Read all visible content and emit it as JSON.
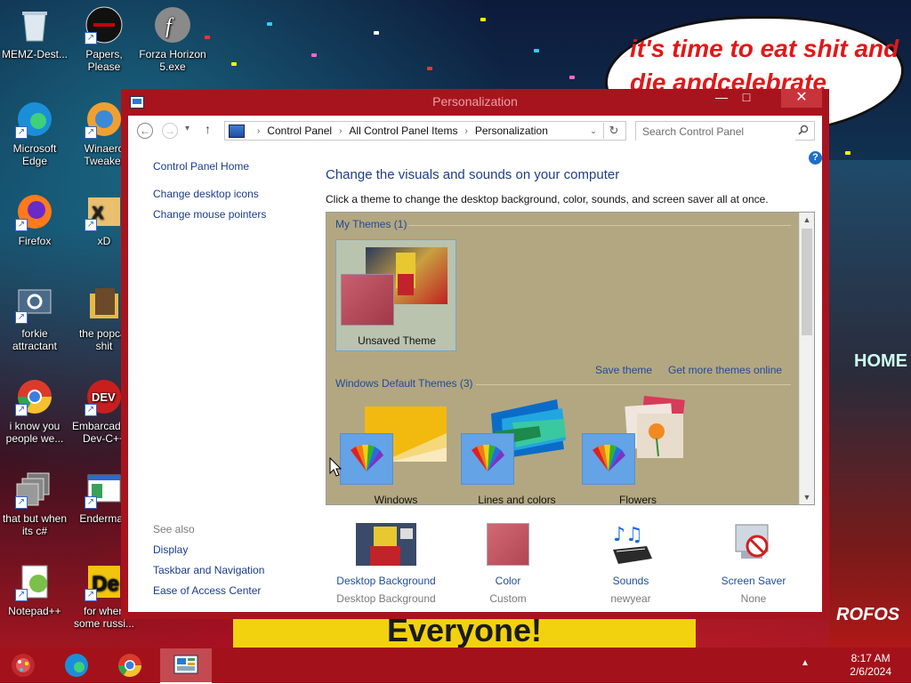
{
  "desktop": {
    "bubble_text": "it's time to eat shit and die andcelebrate",
    "banner_text": "Everyone!",
    "side_text": "ROFOS",
    "side_text2": "HOME",
    "icons": [
      {
        "label": "MEMZ-Dest...",
        "icon": "recycle-bin-icon"
      },
      {
        "label": "Papers, Please",
        "icon": "papers-please-icon"
      },
      {
        "label": "Forza Horizon 5.exe",
        "icon": "flash-icon"
      },
      {
        "label": "Microsoft Edge",
        "icon": "edge-icon"
      },
      {
        "label": "Winaero Tweaker",
        "icon": "winaero-icon"
      },
      {
        "label": "Firefox",
        "icon": "firefox-icon"
      },
      {
        "label": "xD",
        "icon": "xd-icon"
      },
      {
        "label": "forkie attractant",
        "icon": "settings-pc-icon"
      },
      {
        "label": "the popcat shit",
        "icon": "folder-icon"
      },
      {
        "label": "i know you people we...",
        "icon": "chrome-icon"
      },
      {
        "label": "Embarcadero Dev-C++",
        "icon": "devcpp-icon"
      },
      {
        "label": "that but when its c#",
        "icon": "copy-windows-icon"
      },
      {
        "label": "Enderman",
        "icon": "window-app-icon"
      },
      {
        "label": "Notepad++",
        "icon": "notepadpp-icon"
      },
      {
        "label": "for when some russi...",
        "icon": "dex-icon"
      }
    ]
  },
  "taskbar": {
    "time": "8:17 AM",
    "date": "2/6/2024",
    "tray_arrow": "▲",
    "pinned": [
      {
        "name": "start-button",
        "icon": "start-orb-icon"
      },
      {
        "name": "taskbar-edge",
        "icon": "edge-icon"
      },
      {
        "name": "taskbar-chrome",
        "icon": "chrome-icon"
      },
      {
        "name": "taskbar-control-panel",
        "icon": "control-panel-icon"
      }
    ]
  },
  "window": {
    "title": "Personalization",
    "minimize": "—",
    "maximize": "□",
    "close": "✕",
    "nav": {
      "back": "←",
      "forward": "→",
      "recent": "▾",
      "up": "↑",
      "dropdown": "⌄",
      "refresh": "↻",
      "breadcrumbs": [
        "Control Panel",
        "All Control Panel Items",
        "Personalization"
      ],
      "search_placeholder": "Search Control Panel"
    },
    "help": "?",
    "left": {
      "home": "Control Panel Home",
      "links": [
        "Change desktop icons",
        "Change mouse pointers"
      ],
      "see_also_title": "See also",
      "see_also": [
        "Display",
        "Taskbar and Navigation",
        "Ease of Access Center"
      ]
    },
    "heading": "Change the visuals and sounds on your computer",
    "subtext": "Click a theme to change the desktop background, color, sounds, and screen saver all at once.",
    "themes": {
      "my_themes_label": "My Themes (1)",
      "my_themes": [
        {
          "name": "Unsaved Theme",
          "swatch": "#b54a58"
        }
      ],
      "save_theme": "Save theme",
      "get_more": "Get more themes online",
      "default_label": "Windows Default Themes (3)",
      "default_themes": [
        {
          "name": "Windows",
          "wall": "#f2b90f"
        },
        {
          "name": "Lines and colors",
          "wall": "#1f8fd8"
        },
        {
          "name": "Flowers",
          "wall": "#e8e4d8"
        }
      ]
    },
    "settings": [
      {
        "label": "Desktop Background",
        "value": "Desktop Background",
        "icon": "desktop-background-thumb"
      },
      {
        "label": "Color",
        "value": "Custom",
        "icon": "color-swatch-icon",
        "color": "#c2555f"
      },
      {
        "label": "Sounds",
        "value": "newyear",
        "icon": "sounds-icon"
      },
      {
        "label": "Screen Saver",
        "value": "None",
        "icon": "screen-saver-icon"
      }
    ]
  },
  "colors": {
    "window_frame": "#a8141e",
    "taskbar": "#a3121a",
    "link": "#1a3b8a",
    "theme_pane": "#b3a781"
  }
}
